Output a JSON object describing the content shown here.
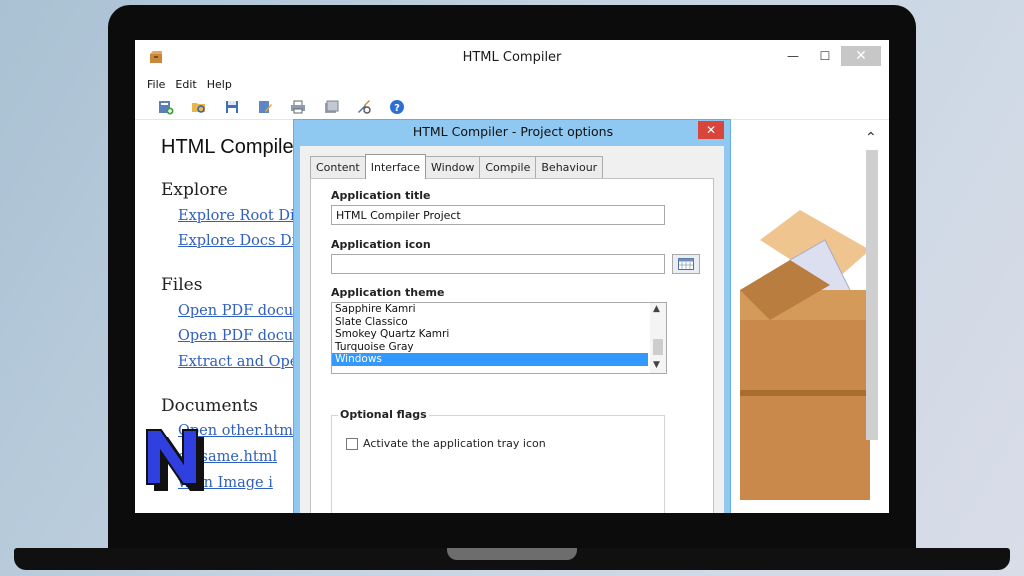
{
  "window": {
    "title": "HTML Compiler",
    "controls": {
      "minimize": "—",
      "maximize": "☐",
      "close": "✕"
    }
  },
  "menu": [
    "File",
    "Edit",
    "Help"
  ],
  "toolbar": {
    "icons": [
      "new-project-icon",
      "open-project-icon",
      "save-icon",
      "edit-icon",
      "print-icon",
      "compile-icon",
      "tools-icon",
      "help-icon"
    ]
  },
  "document": {
    "heading": "HTML Compile",
    "sections": [
      {
        "title": "Explore",
        "links": [
          "Explore Root Di",
          "Explore Docs Di"
        ]
      },
      {
        "title": "Files",
        "links": [
          "Open PDF docu",
          "Open PDF docu",
          "Extract and Ope"
        ]
      },
      {
        "title": "Documents",
        "links": [
          "Open other.html",
          "en same.html",
          "w an Image i"
        ]
      }
    ]
  },
  "dialog": {
    "title": "HTML Compiler - Project options",
    "close": "✕",
    "tabs": [
      "Content",
      "Interface",
      "Window",
      "Compile",
      "Behaviour"
    ],
    "active_tab": "Interface",
    "app_title_label": "Application title",
    "app_title_value": "HTML Compiler Project",
    "app_icon_label": "Application icon",
    "app_icon_value": "",
    "theme_label": "Application theme",
    "themes": [
      "Sapphire Kamri",
      "Slate Classico",
      "Smokey Quartz Kamri",
      "Turquoise Gray",
      "Windows"
    ],
    "selected_theme": "Windows",
    "flags_label": "Optional flags",
    "tray_icon_label": "Activate the application tray icon",
    "tray_icon_checked": false
  },
  "colors": {
    "dialog_frame": "#8fc8f0",
    "selection": "#3399ff",
    "link": "#2f5fc0",
    "close_red": "#d9443b",
    "logo_blue": "#2f3fe0"
  },
  "logo": {
    "letter": "N"
  }
}
